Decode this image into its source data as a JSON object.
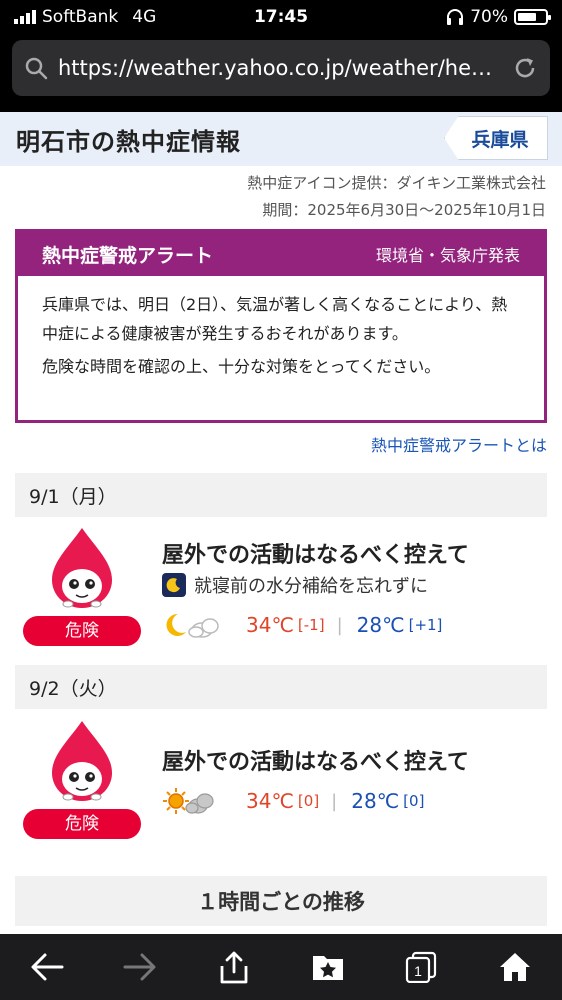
{
  "status_bar": {
    "carrier": "SoftBank",
    "network": "4G",
    "time": "17:45",
    "battery": "70%",
    "battery_level": 0.7
  },
  "browser": {
    "url": "https://weather.yahoo.co.jp/weather/heatstr..."
  },
  "header": {
    "title": "明石市の熱中症情報",
    "prefecture_link": "兵庫県"
  },
  "credits": {
    "icon_provider": "熱中症アイコン提供：ダイキン工業株式会社",
    "period": "期間：2025年6月30日〜2025年10月1日"
  },
  "alert": {
    "title": "熱中症警戒アラート",
    "issuer": "環境省・気象庁発表",
    "body1": "兵庫県では、明日（2日）、気温が著しく高くなることにより、熱中症による健康被害が発生するおそれがあります。",
    "body2": "危険な時間を確認の上、十分な対策をとってください。",
    "link": "熱中症警戒アラートとは"
  },
  "days": [
    {
      "date": "9/1（月）",
      "level": "危険",
      "advice": "屋外での活動はなるべく控えて",
      "tip": "就寝前の水分補給を忘れずに",
      "weather_icon": "moon-cloud-icon",
      "high": "34℃",
      "high_diff": "[-1]",
      "low": "28℃",
      "low_diff": "[+1]"
    },
    {
      "date": "9/2（火）",
      "level": "危険",
      "advice": "屋外での活動はなるべく控えて",
      "weather_icon": "sun-cloud-icon",
      "high": "34℃",
      "high_diff": "[0]",
      "low": "28℃",
      "low_diff": "[0]"
    }
  ],
  "hourly": {
    "title": "１時間ごとの推移"
  },
  "colors": {
    "alert": "#94237e",
    "danger": "#e60033",
    "high": "#e0452a",
    "low": "#1a4fb4",
    "link": "#1a56b6"
  }
}
